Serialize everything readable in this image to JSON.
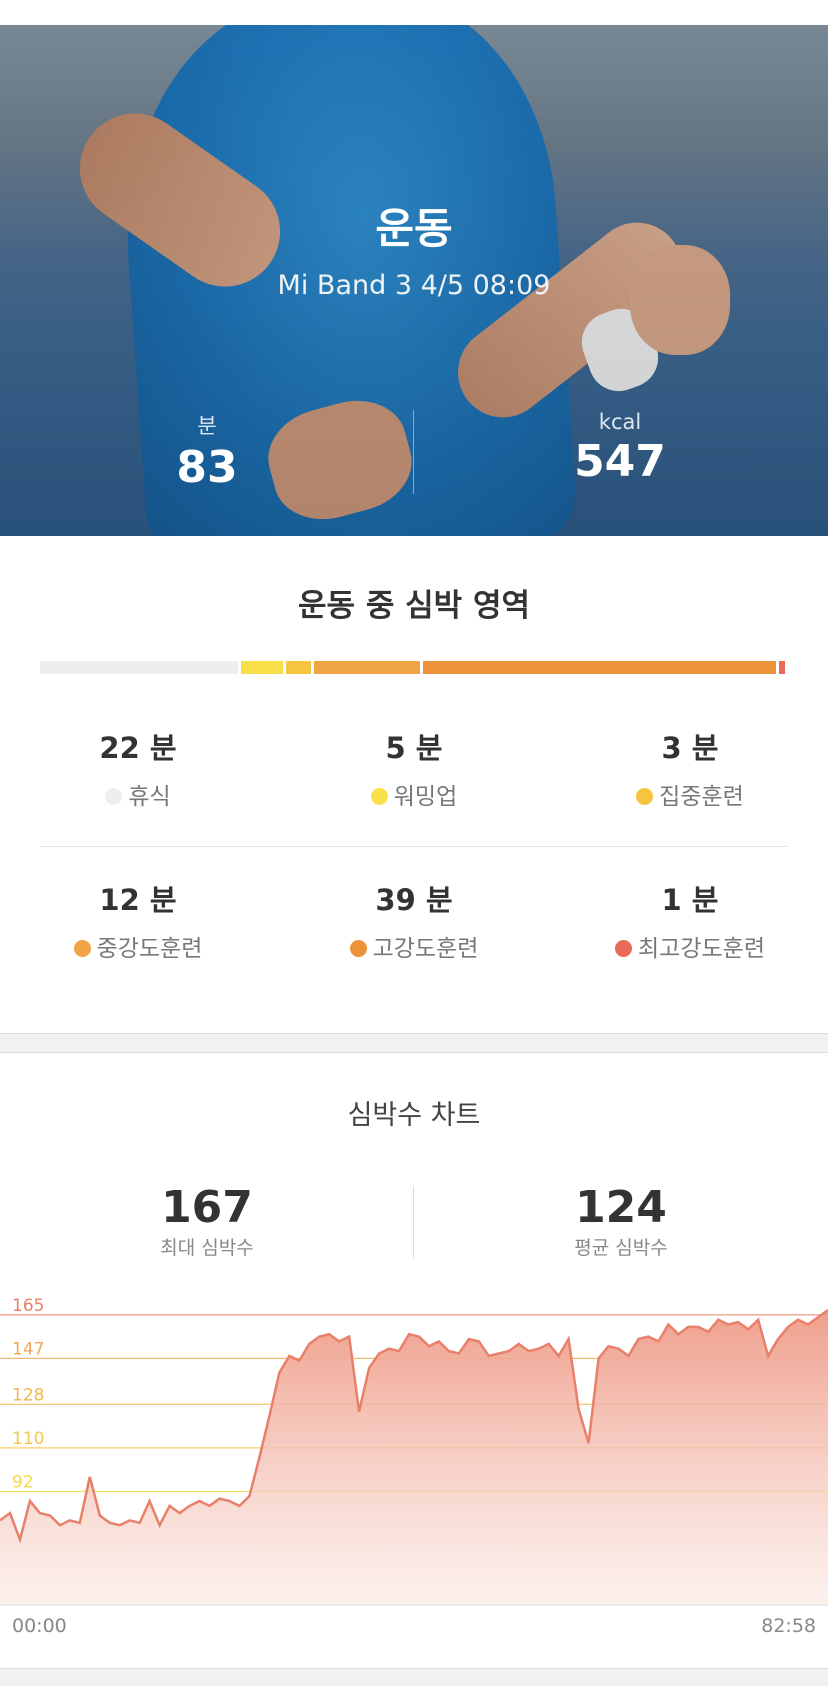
{
  "hero": {
    "title": "운동",
    "subtitle": "Mi Band 3 4/5 08:09",
    "duration": {
      "label": "분",
      "value": "83"
    },
    "calories": {
      "label": "kcal",
      "value": "547"
    }
  },
  "zones": {
    "title": "운동 중 심박 영역",
    "items": [
      {
        "minutes": "22 분",
        "name": "휴식",
        "color": "#eeeeee",
        "value": 22
      },
      {
        "minutes": "5 분",
        "name": "워밍업",
        "color": "#f9e04b",
        "value": 5
      },
      {
        "minutes": "3 분",
        "name": "집중훈련",
        "color": "#f5c540",
        "value": 3
      },
      {
        "minutes": "12 분",
        "name": "중강도훈련",
        "color": "#f0a445",
        "value": 12
      },
      {
        "minutes": "39 분",
        "name": "고강도훈련",
        "color": "#ee913b",
        "value": 39
      },
      {
        "minutes": "1 분",
        "name": "최고강도훈련",
        "color": "#e96a5a",
        "value": 1
      }
    ]
  },
  "heart_chart": {
    "title": "심박수 차트",
    "max": {
      "value": "167",
      "label": "최대 심박수"
    },
    "avg": {
      "value": "124",
      "label": "평균 심박수"
    },
    "x_start": "00:00",
    "x_end": "82:58"
  },
  "chart_data": {
    "type": "area",
    "title": "심박수 차트",
    "x_range": [
      "00:00",
      "82:58"
    ],
    "y_reference_lines": [
      {
        "value": 165,
        "color": "#e8806a"
      },
      {
        "value": 147,
        "color": "#eeaa55"
      },
      {
        "value": 128,
        "color": "#f0b850"
      },
      {
        "value": 110,
        "color": "#f3c84a"
      },
      {
        "value": 92,
        "color": "#f6d84a"
      }
    ],
    "series": [
      {
        "x_minutes": [
          0,
          1,
          2,
          3,
          4,
          5,
          6,
          7,
          8,
          9,
          10,
          11,
          12,
          13,
          14,
          15,
          16,
          17,
          18,
          19,
          20,
          21,
          22,
          23,
          24,
          25,
          26,
          27,
          28,
          29,
          30,
          31,
          32,
          33,
          34,
          35,
          36,
          37,
          38,
          39,
          40,
          41,
          42,
          43,
          44,
          45,
          46,
          47,
          48,
          49,
          50,
          51,
          52,
          53,
          54,
          55,
          56,
          57,
          58,
          59,
          60,
          61,
          62,
          63,
          64,
          65,
          66,
          67,
          68,
          69,
          70,
          71,
          72,
          73,
          74,
          75,
          76,
          77,
          78,
          79,
          80,
          81,
          82,
          83
        ],
        "values": [
          80,
          83,
          72,
          88,
          83,
          82,
          78,
          80,
          79,
          98,
          82,
          79,
          78,
          80,
          79,
          88,
          78,
          86,
          83,
          86,
          88,
          86,
          89,
          88,
          86,
          90,
          106,
          123,
          141,
          148,
          146,
          153,
          156,
          157,
          154,
          156,
          125,
          143,
          149,
          151,
          150,
          157,
          156,
          152,
          154,
          150,
          149,
          155,
          154,
          148,
          149,
          150,
          153,
          150,
          151,
          153,
          148,
          155,
          126,
          112,
          147,
          152,
          151,
          148,
          155,
          156,
          154,
          161,
          157,
          160,
          160,
          158,
          163,
          161,
          162,
          159,
          163,
          148,
          155,
          160,
          163,
          161,
          164,
          167
        ]
      }
    ]
  }
}
